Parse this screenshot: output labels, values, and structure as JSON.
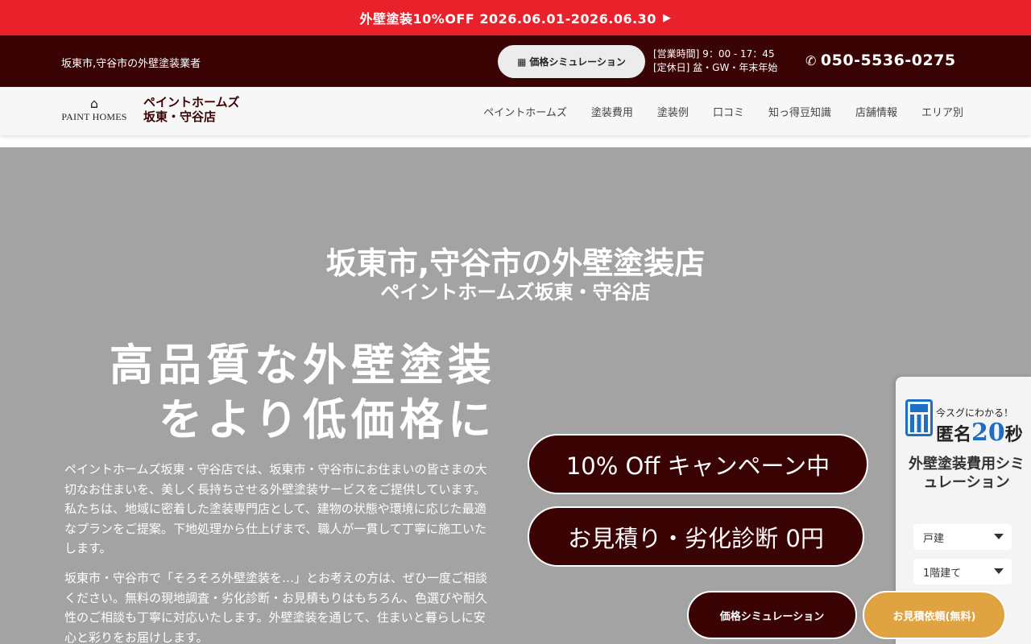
{
  "promo": {
    "text": "外壁塗装10%OFF 2026.06.01-2026.06.30",
    "arrow": "▶"
  },
  "topbar": {
    "tagline": "坂東市,守谷市の外壁塗装業者",
    "sim_button": "価格シミュレーション",
    "hours_line1": "[営業時間] 9：00 - 17：45",
    "hours_line2": "[定休日] 盆・GW・年末年始",
    "phone": "050-5536-0275"
  },
  "header": {
    "logo_text": "PAINT HOMES",
    "store_line1": "ペイントホームズ",
    "store_line2": "坂東・守谷店",
    "nav": [
      "ペイントホームズ",
      "塗装費用",
      "塗装例",
      "口コミ",
      "知っ得豆知識",
      "店舗情報",
      "エリア別"
    ]
  },
  "hero": {
    "title": "坂東市,守谷市の外壁塗装店",
    "subtitle": "ペイントホームズ坂東・守谷店",
    "catch_line1": "高品質な外壁塗装",
    "catch_line2": "をより低価格に",
    "desc1": "ペイントホームズ坂東・守谷店では、坂東市・守谷市にお住まいの皆さまの大切なお住まいを、美しく長持ちさせる外壁塗装サービスをご提供しています。私たちは、地域に密着した塗装専門店として、建物の状態や環境に応じた最適なプランをご提案。下地処理から仕上げまで、職人が一貫して丁寧に施工いたします。",
    "desc2": "坂東市・守谷市で「そろそろ外壁塗装を…」とお考えの方は、ぜひ一度ご相談ください。無料の現地調査・劣化診断・お見積もりはもちろん、色選びや耐久性のご相談も丁寧に対応いたします。外壁塗装を通じて、住まいと暮らしに安心と彩りをお届けします。",
    "pill1": "10% Off キャンペーン中",
    "pill2": "お見積り・劣化診断 0円"
  },
  "side_panel": {
    "instant": "今スグにわかる！",
    "anon_prefix": "匿名",
    "anon_num": "20",
    "anon_suffix": "秒",
    "title": "外壁塗装費用シミュレーション",
    "select1": "戸建",
    "select2": "1階建て"
  },
  "floating": {
    "sim": "価格シミュレーション",
    "estimate": "お見積依頼(無料)"
  },
  "colors": {
    "promo_red": "#e8212a",
    "dark_maroon": "#3a0304",
    "hero_gray": "#a3a3a3",
    "accent_blue": "#1e6fc2",
    "estimate_orange": "#e0a342"
  }
}
